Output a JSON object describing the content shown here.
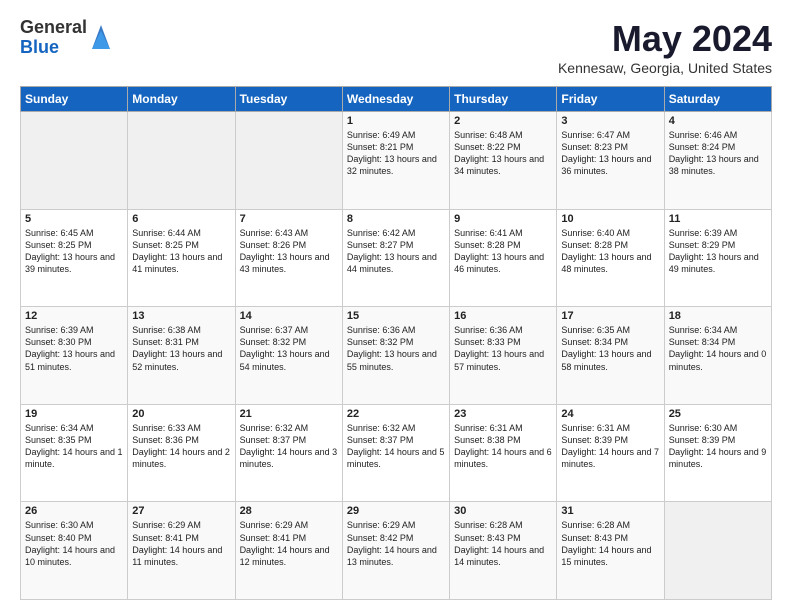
{
  "logo": {
    "general": "General",
    "blue": "Blue"
  },
  "title": "May 2024",
  "location": "Kennesaw, Georgia, United States",
  "weekdays": [
    "Sunday",
    "Monday",
    "Tuesday",
    "Wednesday",
    "Thursday",
    "Friday",
    "Saturday"
  ],
  "weeks": [
    [
      {
        "day": "",
        "sunrise": "",
        "sunset": "",
        "daylight": ""
      },
      {
        "day": "",
        "sunrise": "",
        "sunset": "",
        "daylight": ""
      },
      {
        "day": "",
        "sunrise": "",
        "sunset": "",
        "daylight": ""
      },
      {
        "day": "1",
        "sunrise": "Sunrise: 6:49 AM",
        "sunset": "Sunset: 8:21 PM",
        "daylight": "Daylight: 13 hours and 32 minutes."
      },
      {
        "day": "2",
        "sunrise": "Sunrise: 6:48 AM",
        "sunset": "Sunset: 8:22 PM",
        "daylight": "Daylight: 13 hours and 34 minutes."
      },
      {
        "day": "3",
        "sunrise": "Sunrise: 6:47 AM",
        "sunset": "Sunset: 8:23 PM",
        "daylight": "Daylight: 13 hours and 36 minutes."
      },
      {
        "day": "4",
        "sunrise": "Sunrise: 6:46 AM",
        "sunset": "Sunset: 8:24 PM",
        "daylight": "Daylight: 13 hours and 38 minutes."
      }
    ],
    [
      {
        "day": "5",
        "sunrise": "Sunrise: 6:45 AM",
        "sunset": "Sunset: 8:25 PM",
        "daylight": "Daylight: 13 hours and 39 minutes."
      },
      {
        "day": "6",
        "sunrise": "Sunrise: 6:44 AM",
        "sunset": "Sunset: 8:25 PM",
        "daylight": "Daylight: 13 hours and 41 minutes."
      },
      {
        "day": "7",
        "sunrise": "Sunrise: 6:43 AM",
        "sunset": "Sunset: 8:26 PM",
        "daylight": "Daylight: 13 hours and 43 minutes."
      },
      {
        "day": "8",
        "sunrise": "Sunrise: 6:42 AM",
        "sunset": "Sunset: 8:27 PM",
        "daylight": "Daylight: 13 hours and 44 minutes."
      },
      {
        "day": "9",
        "sunrise": "Sunrise: 6:41 AM",
        "sunset": "Sunset: 8:28 PM",
        "daylight": "Daylight: 13 hours and 46 minutes."
      },
      {
        "day": "10",
        "sunrise": "Sunrise: 6:40 AM",
        "sunset": "Sunset: 8:28 PM",
        "daylight": "Daylight: 13 hours and 48 minutes."
      },
      {
        "day": "11",
        "sunrise": "Sunrise: 6:39 AM",
        "sunset": "Sunset: 8:29 PM",
        "daylight": "Daylight: 13 hours and 49 minutes."
      }
    ],
    [
      {
        "day": "12",
        "sunrise": "Sunrise: 6:39 AM",
        "sunset": "Sunset: 8:30 PM",
        "daylight": "Daylight: 13 hours and 51 minutes."
      },
      {
        "day": "13",
        "sunrise": "Sunrise: 6:38 AM",
        "sunset": "Sunset: 8:31 PM",
        "daylight": "Daylight: 13 hours and 52 minutes."
      },
      {
        "day": "14",
        "sunrise": "Sunrise: 6:37 AM",
        "sunset": "Sunset: 8:32 PM",
        "daylight": "Daylight: 13 hours and 54 minutes."
      },
      {
        "day": "15",
        "sunrise": "Sunrise: 6:36 AM",
        "sunset": "Sunset: 8:32 PM",
        "daylight": "Daylight: 13 hours and 55 minutes."
      },
      {
        "day": "16",
        "sunrise": "Sunrise: 6:36 AM",
        "sunset": "Sunset: 8:33 PM",
        "daylight": "Daylight: 13 hours and 57 minutes."
      },
      {
        "day": "17",
        "sunrise": "Sunrise: 6:35 AM",
        "sunset": "Sunset: 8:34 PM",
        "daylight": "Daylight: 13 hours and 58 minutes."
      },
      {
        "day": "18",
        "sunrise": "Sunrise: 6:34 AM",
        "sunset": "Sunset: 8:34 PM",
        "daylight": "Daylight: 14 hours and 0 minutes."
      }
    ],
    [
      {
        "day": "19",
        "sunrise": "Sunrise: 6:34 AM",
        "sunset": "Sunset: 8:35 PM",
        "daylight": "Daylight: 14 hours and 1 minute."
      },
      {
        "day": "20",
        "sunrise": "Sunrise: 6:33 AM",
        "sunset": "Sunset: 8:36 PM",
        "daylight": "Daylight: 14 hours and 2 minutes."
      },
      {
        "day": "21",
        "sunrise": "Sunrise: 6:32 AM",
        "sunset": "Sunset: 8:37 PM",
        "daylight": "Daylight: 14 hours and 3 minutes."
      },
      {
        "day": "22",
        "sunrise": "Sunrise: 6:32 AM",
        "sunset": "Sunset: 8:37 PM",
        "daylight": "Daylight: 14 hours and 5 minutes."
      },
      {
        "day": "23",
        "sunrise": "Sunrise: 6:31 AM",
        "sunset": "Sunset: 8:38 PM",
        "daylight": "Daylight: 14 hours and 6 minutes."
      },
      {
        "day": "24",
        "sunrise": "Sunrise: 6:31 AM",
        "sunset": "Sunset: 8:39 PM",
        "daylight": "Daylight: 14 hours and 7 minutes."
      },
      {
        "day": "25",
        "sunrise": "Sunrise: 6:30 AM",
        "sunset": "Sunset: 8:39 PM",
        "daylight": "Daylight: 14 hours and 9 minutes."
      }
    ],
    [
      {
        "day": "26",
        "sunrise": "Sunrise: 6:30 AM",
        "sunset": "Sunset: 8:40 PM",
        "daylight": "Daylight: 14 hours and 10 minutes."
      },
      {
        "day": "27",
        "sunrise": "Sunrise: 6:29 AM",
        "sunset": "Sunset: 8:41 PM",
        "daylight": "Daylight: 14 hours and 11 minutes."
      },
      {
        "day": "28",
        "sunrise": "Sunrise: 6:29 AM",
        "sunset": "Sunset: 8:41 PM",
        "daylight": "Daylight: 14 hours and 12 minutes."
      },
      {
        "day": "29",
        "sunrise": "Sunrise: 6:29 AM",
        "sunset": "Sunset: 8:42 PM",
        "daylight": "Daylight: 14 hours and 13 minutes."
      },
      {
        "day": "30",
        "sunrise": "Sunrise: 6:28 AM",
        "sunset": "Sunset: 8:43 PM",
        "daylight": "Daylight: 14 hours and 14 minutes."
      },
      {
        "day": "31",
        "sunrise": "Sunrise: 6:28 AM",
        "sunset": "Sunset: 8:43 PM",
        "daylight": "Daylight: 14 hours and 15 minutes."
      },
      {
        "day": "",
        "sunrise": "",
        "sunset": "",
        "daylight": ""
      }
    ]
  ]
}
